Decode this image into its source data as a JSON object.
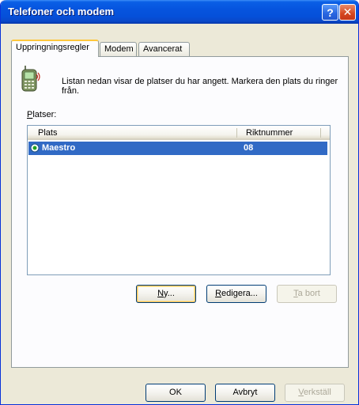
{
  "window": {
    "title": "Telefoner och modem",
    "help_glyph": "?",
    "close_glyph": "✕"
  },
  "tabs": [
    {
      "label": "Uppringningsregler",
      "active": true
    },
    {
      "label": "Modem",
      "active": false
    },
    {
      "label": "Avancerat",
      "active": false
    }
  ],
  "description": {
    "icon": "phone-icon",
    "text": "Listan nedan visar de platser du har angett. Markera den plats du ringer från."
  },
  "locations": {
    "label_prefix": "P",
    "label_rest": "latser:",
    "columns": [
      "Plats",
      "Riktnummer"
    ],
    "rows": [
      {
        "name": "Maestro",
        "area_code": "08",
        "selected": true
      }
    ]
  },
  "location_buttons": {
    "new_underlined": "N",
    "new_rest": "y...",
    "edit_underlined": "R",
    "edit_rest": "edigera...",
    "delete_underlined": "T",
    "delete_rest": "a bort"
  },
  "dialog_buttons": {
    "ok": "OK",
    "cancel": "Avbryt",
    "apply_underlined": "V",
    "apply_rest": "erkställ"
  },
  "colors": {
    "titlebar": "#0550d9",
    "selection": "#316ac5",
    "face": "#ece9d8"
  }
}
